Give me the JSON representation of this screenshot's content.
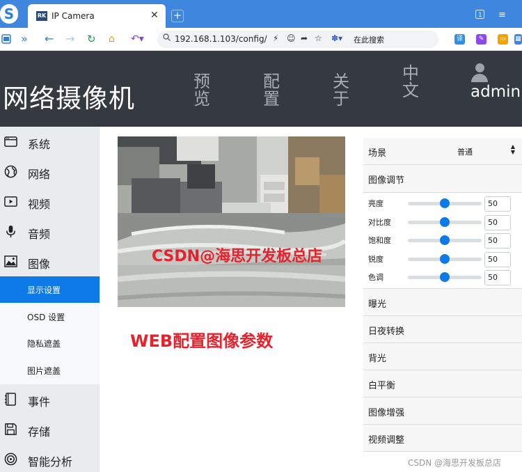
{
  "browser": {
    "tab_title": "IP Camera",
    "tab_favicon_text": "RK",
    "url": "192.168.1.103/config/",
    "search_placeholder": "在此搜索"
  },
  "header": {
    "title": "网络摄像机",
    "nav": [
      {
        "line1": "预",
        "line2": "览"
      },
      {
        "line1": "配",
        "line2": "置"
      },
      {
        "line1": "关",
        "line2": "于"
      },
      {
        "line1": "中",
        "line2": "文"
      }
    ],
    "username": "admin"
  },
  "sidebar": {
    "items": [
      {
        "label": "系统",
        "icon": "system-icon"
      },
      {
        "label": "网络",
        "icon": "globe-icon"
      },
      {
        "label": "视频",
        "icon": "video-icon"
      },
      {
        "label": "音频",
        "icon": "microphone-icon"
      },
      {
        "label": "图像",
        "icon": "image-icon"
      }
    ],
    "subitems": [
      {
        "label": "显示设置",
        "active": true
      },
      {
        "label": "OSD 设置",
        "active": false
      },
      {
        "label": "隐私遮盖",
        "active": false
      },
      {
        "label": "图片遮盖",
        "active": false
      }
    ],
    "items_after": [
      {
        "label": "事件",
        "icon": "event-icon"
      },
      {
        "label": "存储",
        "icon": "storage-icon"
      },
      {
        "label": "智能分析",
        "icon": "analysis-icon"
      }
    ]
  },
  "preview": {
    "overlay_text": "CSDN@海思开发板总店",
    "caption": "WEB配置图像参数"
  },
  "settings": {
    "scene": {
      "label": "场景",
      "value": "普通"
    },
    "image_adjust_label": "图像调节",
    "sliders": [
      {
        "label": "亮度",
        "value": "50",
        "fraction": 0.5
      },
      {
        "label": "对比度",
        "value": "50",
        "fraction": 0.5
      },
      {
        "label": "饱和度",
        "value": "50",
        "fraction": 0.5
      },
      {
        "label": "锐度",
        "value": "50",
        "fraction": 0.5
      },
      {
        "label": "色调",
        "value": "50",
        "fraction": 0.5
      }
    ],
    "sections": [
      "曝光",
      "日夜转换",
      "背光",
      "白平衡",
      "图像增强",
      "视频调整"
    ]
  },
  "watermark": "CSDN @海思开发板总店",
  "colors": {
    "header_bg": "#343a40",
    "accent": "#0d7ae8",
    "overlay_red": "#e8222c",
    "browser_blue": "#3f86de"
  }
}
